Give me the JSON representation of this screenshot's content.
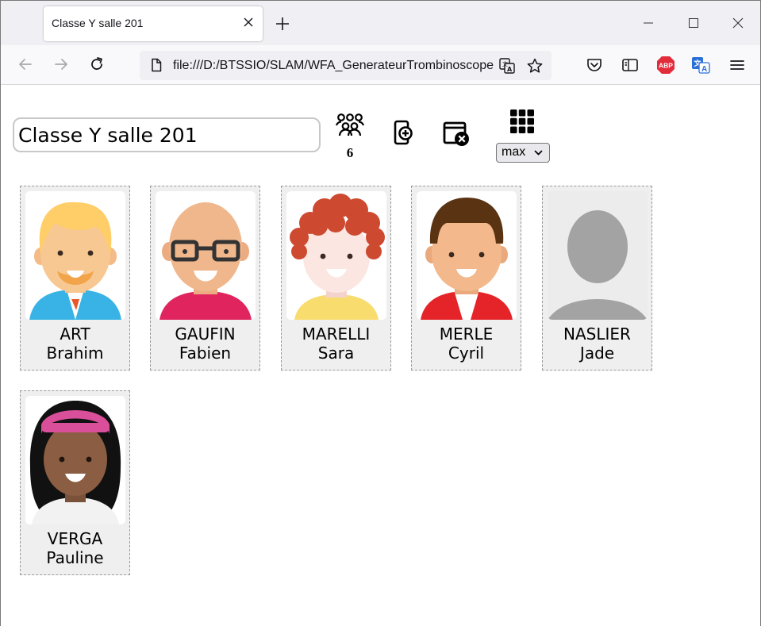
{
  "browser": {
    "tab_title": "Classe Y salle 201",
    "url": "file:///D:/BTSSIO/SLAM/WFA_GenerateurTrombinoscope",
    "adblock_badge": "ABP"
  },
  "page": {
    "class_name_value": "Classe Y salle 201",
    "student_count": "6",
    "size_select": {
      "selected": "max"
    }
  },
  "students": [
    {
      "nom": "ART",
      "prenom": "Brahim",
      "avatar": "blond-beard-boy"
    },
    {
      "nom": "GAUFIN",
      "prenom": "Fabien",
      "avatar": "bald-glasses-man"
    },
    {
      "nom": "MARELLI",
      "prenom": "Sara",
      "avatar": "red-curly-hair-girl"
    },
    {
      "nom": "MERLE",
      "prenom": "Cyril",
      "avatar": "brown-hair-boy"
    },
    {
      "nom": "NASLIER",
      "prenom": "Jade",
      "avatar": "default-silhouette"
    },
    {
      "nom": "VERGA",
      "prenom": "Pauline",
      "avatar": "black-hair-headband-girl"
    }
  ]
}
